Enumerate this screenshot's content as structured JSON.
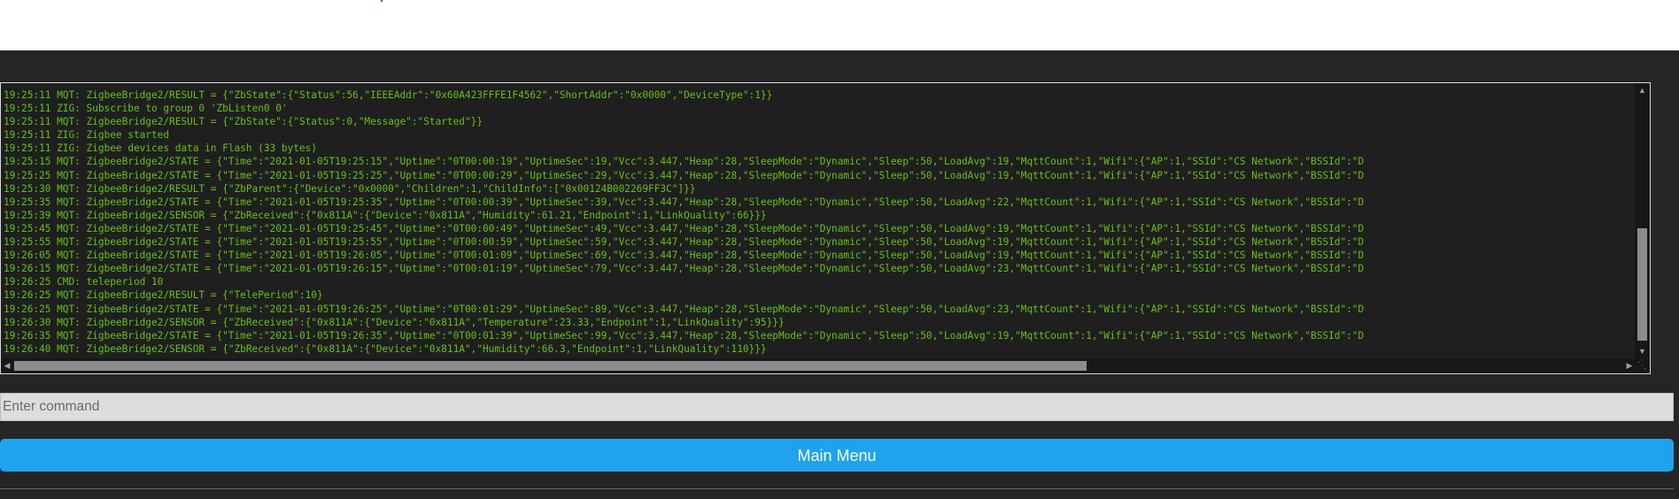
{
  "console": {
    "lines": [
      "19:25:11 MQT: ZigbeeBridge2/RESULT = {\"ZbState\":{\"Status\":56,\"IEEEAddr\":\"0x60A423FFFE1F4562\",\"ShortAddr\":\"0x0000\",\"DeviceType\":1}}",
      "19:25:11 ZIG: Subscribe to group 0 'ZbListen0 0'",
      "19:25:11 MQT: ZigbeeBridge2/RESULT = {\"ZbState\":{\"Status\":0,\"Message\":\"Started\"}}",
      "19:25:11 ZIG: Zigbee started",
      "19:25:11 ZIG: Zigbee devices data in Flash (33 bytes)",
      "19:25:15 MQT: ZigbeeBridge2/STATE = {\"Time\":\"2021-01-05T19:25:15\",\"Uptime\":\"0T00:00:19\",\"UptimeSec\":19,\"Vcc\":3.447,\"Heap\":28,\"SleepMode\":\"Dynamic\",\"Sleep\":50,\"LoadAvg\":19,\"MqttCount\":1,\"Wifi\":{\"AP\":1,\"SSId\":\"CS Network\",\"BSSId\":\"D",
      "19:25:25 MQT: ZigbeeBridge2/STATE = {\"Time\":\"2021-01-05T19:25:25\",\"Uptime\":\"0T00:00:29\",\"UptimeSec\":29,\"Vcc\":3.447,\"Heap\":28,\"SleepMode\":\"Dynamic\",\"Sleep\":50,\"LoadAvg\":19,\"MqttCount\":1,\"Wifi\":{\"AP\":1,\"SSId\":\"CS Network\",\"BSSId\":\"D",
      "19:25:30 MQT: ZigbeeBridge2/RESULT = {\"ZbParent\":{\"Device\":\"0x0000\",\"Children\":1,\"ChildInfo\":[\"0x00124B002269FF3C\"]}}",
      "19:25:35 MQT: ZigbeeBridge2/STATE = {\"Time\":\"2021-01-05T19:25:35\",\"Uptime\":\"0T00:00:39\",\"UptimeSec\":39,\"Vcc\":3.447,\"Heap\":28,\"SleepMode\":\"Dynamic\",\"Sleep\":50,\"LoadAvg\":22,\"MqttCount\":1,\"Wifi\":{\"AP\":1,\"SSId\":\"CS Network\",\"BSSId\":\"D",
      "19:25:39 MQT: ZigbeeBridge2/SENSOR = {\"ZbReceived\":{\"0x811A\":{\"Device\":\"0x811A\",\"Humidity\":61.21,\"Endpoint\":1,\"LinkQuality\":66}}}",
      "19:25:45 MQT: ZigbeeBridge2/STATE = {\"Time\":\"2021-01-05T19:25:45\",\"Uptime\":\"0T00:00:49\",\"UptimeSec\":49,\"Vcc\":3.447,\"Heap\":28,\"SleepMode\":\"Dynamic\",\"Sleep\":50,\"LoadAvg\":19,\"MqttCount\":1,\"Wifi\":{\"AP\":1,\"SSId\":\"CS Network\",\"BSSId\":\"D",
      "19:25:55 MQT: ZigbeeBridge2/STATE = {\"Time\":\"2021-01-05T19:25:55\",\"Uptime\":\"0T00:00:59\",\"UptimeSec\":59,\"Vcc\":3.447,\"Heap\":28,\"SleepMode\":\"Dynamic\",\"Sleep\":50,\"LoadAvg\":19,\"MqttCount\":1,\"Wifi\":{\"AP\":1,\"SSId\":\"CS Network\",\"BSSId\":\"D",
      "19:26:05 MQT: ZigbeeBridge2/STATE = {\"Time\":\"2021-01-05T19:26:05\",\"Uptime\":\"0T00:01:09\",\"UptimeSec\":69,\"Vcc\":3.447,\"Heap\":28,\"SleepMode\":\"Dynamic\",\"Sleep\":50,\"LoadAvg\":19,\"MqttCount\":1,\"Wifi\":{\"AP\":1,\"SSId\":\"CS Network\",\"BSSId\":\"D",
      "19:26:15 MQT: ZigbeeBridge2/STATE = {\"Time\":\"2021-01-05T19:26:15\",\"Uptime\":\"0T00:01:19\",\"UptimeSec\":79,\"Vcc\":3.447,\"Heap\":28,\"SleepMode\":\"Dynamic\",\"Sleep\":50,\"LoadAvg\":23,\"MqttCount\":1,\"Wifi\":{\"AP\":1,\"SSId\":\"CS Network\",\"BSSId\":\"D",
      "19:26:25 CMD: teleperiod 10",
      "19:26:25 MQT: ZigbeeBridge2/RESULT = {\"TelePeriod\":10}",
      "19:26:25 MQT: ZigbeeBridge2/STATE = {\"Time\":\"2021-01-05T19:26:25\",\"Uptime\":\"0T00:01:29\",\"UptimeSec\":89,\"Vcc\":3.447,\"Heap\":28,\"SleepMode\":\"Dynamic\",\"Sleep\":50,\"LoadAvg\":23,\"MqttCount\":1,\"Wifi\":{\"AP\":1,\"SSId\":\"CS Network\",\"BSSId\":\"D",
      "19:26:30 MQT: ZigbeeBridge2/SENSOR = {\"ZbReceived\":{\"0x811A\":{\"Device\":\"0x811A\",\"Temperature\":23.33,\"Endpoint\":1,\"LinkQuality\":95}}}",
      "19:26:35 MQT: ZigbeeBridge2/STATE = {\"Time\":\"2021-01-05T19:26:35\",\"Uptime\":\"0T00:01:39\",\"UptimeSec\":99,\"Vcc\":3.447,\"Heap\":28,\"SleepMode\":\"Dynamic\",\"Sleep\":50,\"LoadAvg\":19,\"MqttCount\":1,\"Wifi\":{\"AP\":1,\"SSId\":\"CS Network\",\"BSSId\":\"D",
      "19:26:40 MQT: ZigbeeBridge2/SENSOR = {\"ZbReceived\":{\"0x811A\":{\"Device\":\"0x811A\",\"Humidity\":66.3,\"Endpoint\":1,\"LinkQuality\":110}}}"
    ],
    "text_color": "#65c115",
    "background": "#1f1f1f"
  },
  "command": {
    "placeholder": "Enter command",
    "value": ""
  },
  "main_menu": {
    "label": "Main Menu",
    "color": "#1fa3ec"
  },
  "icons": {
    "scroll_up": "triangle-up",
    "scroll_down": "triangle-down",
    "scroll_left": "triangle-left",
    "scroll_right": "triangle-right",
    "resize": "resize-grip"
  }
}
